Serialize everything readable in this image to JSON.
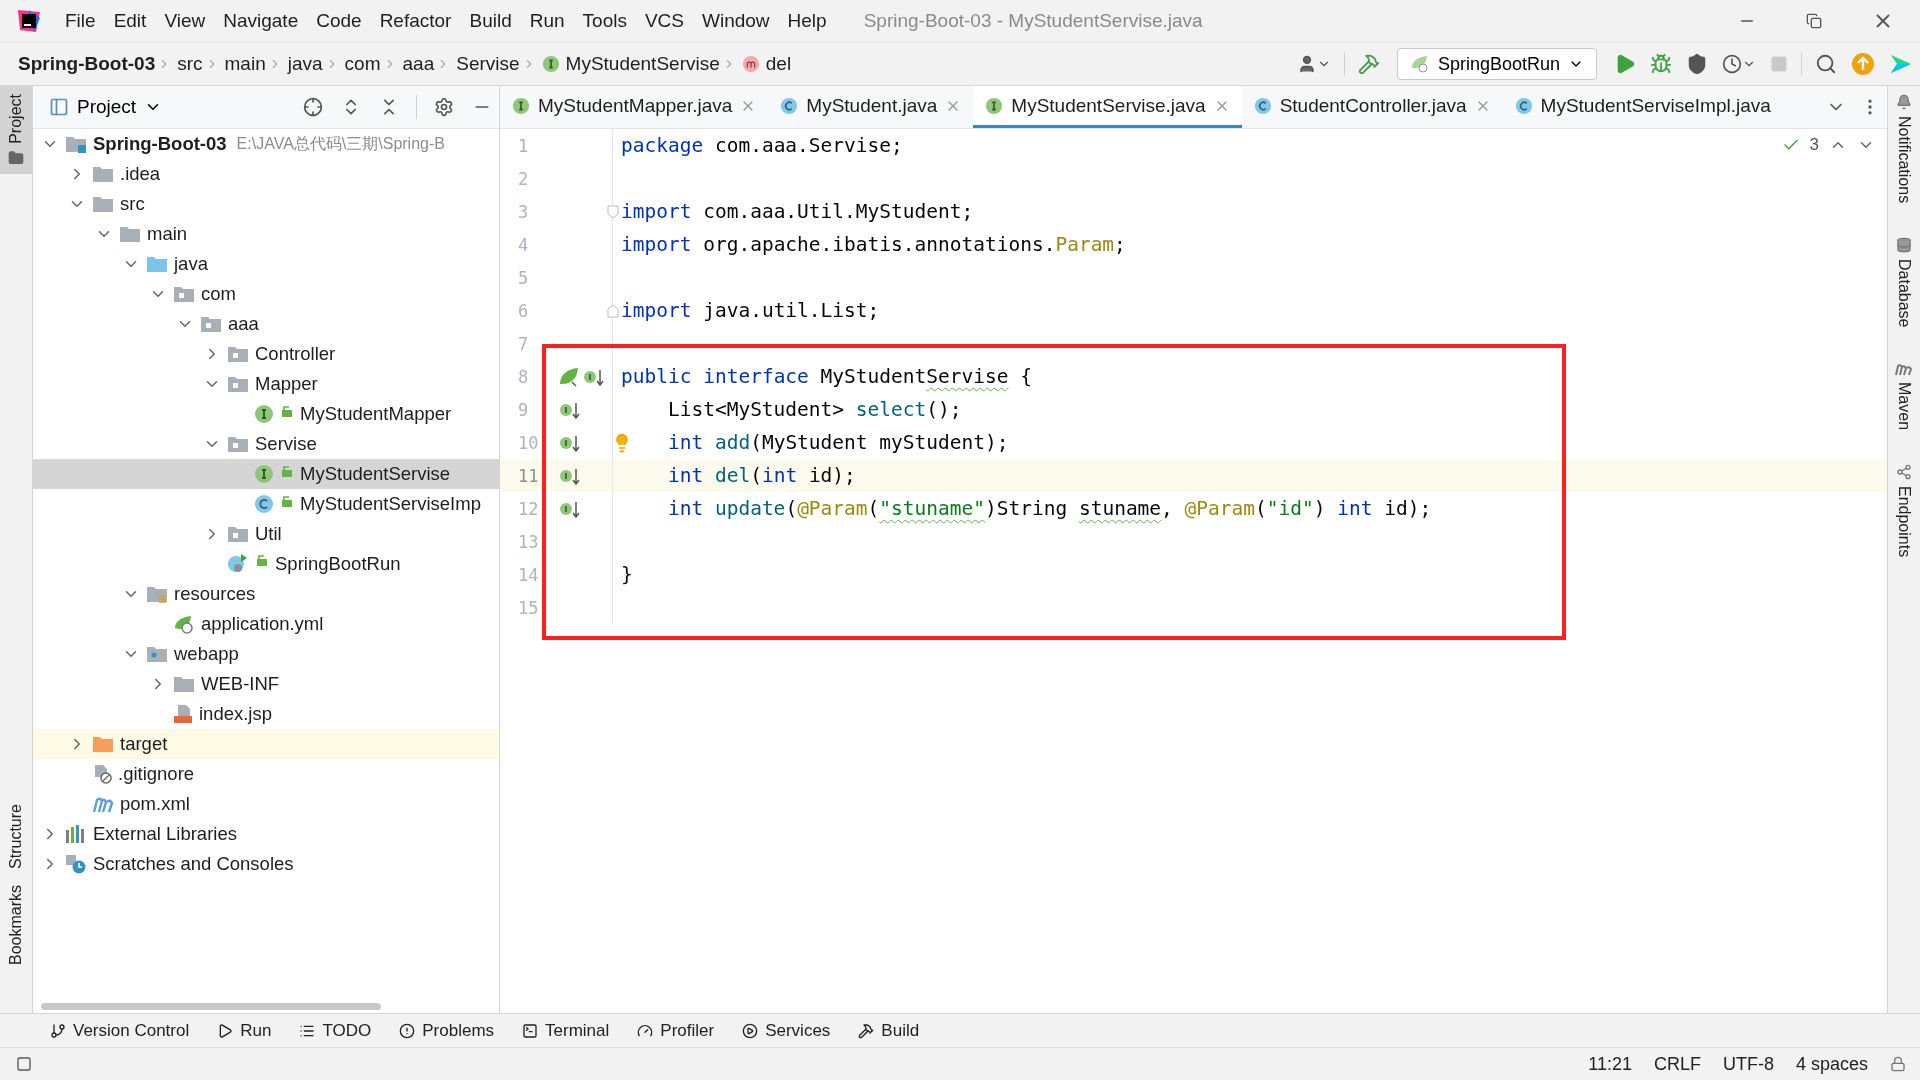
{
  "window": {
    "title": "Spring-Boot-03 - MyStudentServise.java"
  },
  "menu": [
    "File",
    "Edit",
    "View",
    "Navigate",
    "Code",
    "Refactor",
    "Build",
    "Run",
    "Tools",
    "VCS",
    "Window",
    "Help"
  ],
  "breadcrumbs": [
    {
      "label": "Spring-Boot-03",
      "kind": "module"
    },
    {
      "label": "src",
      "kind": "folder"
    },
    {
      "label": "main",
      "kind": "folder"
    },
    {
      "label": "java",
      "kind": "folder"
    },
    {
      "label": "com",
      "kind": "folder"
    },
    {
      "label": "aaa",
      "kind": "folder"
    },
    {
      "label": "Servise",
      "kind": "folder"
    },
    {
      "label": "MyStudentServise",
      "kind": "interface"
    },
    {
      "label": "del",
      "kind": "method"
    }
  ],
  "run_config": "SpringBootRun",
  "left_strip_top": [
    {
      "label": "Project",
      "selected": true
    }
  ],
  "left_strip_bottom": [
    {
      "label": "Structure",
      "selected": false
    },
    {
      "label": "Bookmarks",
      "selected": false
    }
  ],
  "right_strip": [
    {
      "label": "Notifications",
      "kind": "bell"
    },
    {
      "label": "Database",
      "kind": "database"
    },
    {
      "label": "Maven",
      "kind": "maven"
    },
    {
      "label": "Endpoints",
      "kind": "endpoints"
    }
  ],
  "project": {
    "title": "Project",
    "tree": [
      {
        "label": "Spring-Boot-03",
        "hint": "E:\\JAVA总代码\\三期\\Spring-B",
        "kind": "module",
        "expanded": true,
        "selected": false,
        "children": [
          {
            "label": ".idea",
            "kind": "folder",
            "expanded": false,
            "selected": false
          },
          {
            "label": "src",
            "kind": "folder",
            "expanded": true,
            "selected": false,
            "children": [
              {
                "label": "main",
                "kind": "folder",
                "expanded": true,
                "selected": false,
                "children": [
                  {
                    "label": "java",
                    "kind": "source-folder",
                    "expanded": true,
                    "selected": false,
                    "children": [
                      {
                        "label": "com",
                        "kind": "package",
                        "expanded": true,
                        "selected": false,
                        "children": [
                          {
                            "label": "aaa",
                            "kind": "package",
                            "expanded": true,
                            "selected": false,
                            "children": [
                              {
                                "label": "Controller",
                                "kind": "package",
                                "expanded": false,
                                "selected": false
                              },
                              {
                                "label": "Mapper",
                                "kind": "package",
                                "expanded": true,
                                "selected": false,
                                "children": [
                                  {
                                    "label": "MyStudentMapper",
                                    "kind": "interface",
                                    "selected": false
                                  }
                                ]
                              },
                              {
                                "label": "Servise",
                                "kind": "package",
                                "expanded": true,
                                "selected": false,
                                "children": [
                                  {
                                    "label": "MyStudentServise",
                                    "kind": "interface",
                                    "selected": true
                                  },
                                  {
                                    "label": "MyStudentServiseImp",
                                    "kind": "class",
                                    "selected": false
                                  }
                                ]
                              },
                              {
                                "label": "Util",
                                "kind": "package",
                                "expanded": false,
                                "selected": false
                              },
                              {
                                "label": "SpringBootRun",
                                "kind": "spring-class",
                                "selected": false
                              }
                            ]
                          }
                        ]
                      }
                    ]
                  },
                  {
                    "label": "resources",
                    "kind": "resources",
                    "expanded": true,
                    "selected": false,
                    "children": [
                      {
                        "label": "application.yml",
                        "kind": "yml",
                        "selected": false
                      }
                    ]
                  },
                  {
                    "label": "webapp",
                    "kind": "web-folder",
                    "expanded": true,
                    "selected": false,
                    "children": [
                      {
                        "label": "WEB-INF",
                        "kind": "folder",
                        "expanded": false,
                        "selected": false
                      },
                      {
                        "label": "index.jsp",
                        "kind": "jsp",
                        "selected": false
                      }
                    ]
                  }
                ]
              }
            ]
          },
          {
            "label": "target",
            "kind": "excluded-folder",
            "expanded": false,
            "selected": false
          },
          {
            "label": ".gitignore",
            "kind": "gitignore",
            "selected": false
          },
          {
            "label": "pom.xml",
            "kind": "maven",
            "selected": false
          }
        ]
      },
      {
        "label": "External Libraries",
        "kind": "libraries",
        "expanded": false,
        "selected": false
      },
      {
        "label": "Scratches and Consoles",
        "kind": "scratches",
        "expanded": false,
        "selected": false
      }
    ]
  },
  "tabs": [
    {
      "label": "MyStudentMapper.java",
      "kind": "interface",
      "selected": false,
      "closable": true
    },
    {
      "label": "MyStudent.java",
      "kind": "class",
      "selected": false,
      "closable": true
    },
    {
      "label": "MyStudentServise.java",
      "kind": "interface",
      "selected": true,
      "closable": true
    },
    {
      "label": "StudentController.java",
      "kind": "class",
      "selected": false,
      "closable": true
    },
    {
      "label": "MyStudentServiseImpl.java",
      "kind": "class",
      "selected": false,
      "closable": false
    }
  ],
  "editor": {
    "problems": "3",
    "lines": [
      {
        "number": "1",
        "current": false,
        "tokens": [
          {
            "kind": "kw",
            "text": "package"
          },
          {
            "kind": "plain",
            "text": " com.aaa.Servise;"
          }
        ]
      },
      {
        "number": "2",
        "current": false
      },
      {
        "number": "3",
        "current": false,
        "markers": [
          {
            "kind": "fold-start"
          }
        ],
        "tokens": [
          {
            "kind": "kw",
            "text": "import"
          },
          {
            "kind": "plain",
            "text": " com.aaa.Util.MyStudent;"
          }
        ]
      },
      {
        "number": "4",
        "current": false,
        "tokens": [
          {
            "kind": "kw",
            "text": "import"
          },
          {
            "kind": "plain",
            "text": " org.apache.ibatis.annotations."
          },
          {
            "kind": "annot",
            "text": "Param"
          },
          {
            "kind": "plain",
            "text": ";"
          }
        ]
      },
      {
        "number": "5",
        "current": false
      },
      {
        "number": "6",
        "current": false,
        "markers": [
          {
            "kind": "fold-end"
          }
        ],
        "tokens": [
          {
            "kind": "kw",
            "text": "import"
          },
          {
            "kind": "plain",
            "text": " java.util.List;"
          }
        ]
      },
      {
        "number": "7",
        "current": false
      },
      {
        "number": "8",
        "current": false,
        "markers": [
          {
            "kind": "bean"
          },
          {
            "kind": "implemented"
          }
        ],
        "tokens": [
          {
            "kind": "kw",
            "text": "public "
          },
          {
            "kind": "kw",
            "text": "interface"
          },
          {
            "kind": "plain",
            "text": " MyStudent"
          },
          {
            "kind": "typo",
            "text": "Servise"
          },
          {
            "kind": "plain",
            "text": " {"
          }
        ]
      },
      {
        "number": "9",
        "current": false,
        "markers": [
          {
            "kind": "implemented"
          }
        ],
        "tokens": [
          {
            "kind": "plain",
            "text": "    List<MyStudent> "
          },
          {
            "kind": "method",
            "text": "select"
          },
          {
            "kind": "plain",
            "text": "();"
          }
        ]
      },
      {
        "number": "10",
        "current": false,
        "markers": [
          {
            "kind": "implemented"
          },
          {
            "kind": "bulb"
          }
        ],
        "tokens": [
          {
            "kind": "kw",
            "text": "    int "
          },
          {
            "kind": "method",
            "text": "add"
          },
          {
            "kind": "plain",
            "text": "(MyStudent myStudent);"
          }
        ]
      },
      {
        "number": "11",
        "current": true,
        "markers": [
          {
            "kind": "implemented"
          }
        ],
        "tokens": [
          {
            "kind": "kw",
            "text": "    int "
          },
          {
            "kind": "method",
            "text": "del"
          },
          {
            "kind": "plain",
            "text": "("
          },
          {
            "kind": "kw",
            "text": "int"
          },
          {
            "kind": "plain",
            "text": " id);"
          }
        ]
      },
      {
        "number": "12",
        "current": false,
        "markers": [
          {
            "kind": "implemented"
          }
        ],
        "tokens": [
          {
            "kind": "kw",
            "text": "    int "
          },
          {
            "kind": "method",
            "text": "update"
          },
          {
            "kind": "plain",
            "text": "("
          },
          {
            "kind": "annot",
            "text": "@Param"
          },
          {
            "kind": "plain",
            "text": "("
          },
          {
            "kind": "string-typo",
            "text": "\"stuname\""
          },
          {
            "kind": "plain",
            "text": ")String "
          },
          {
            "kind": "typo",
            "text": "stuname"
          },
          {
            "kind": "plain",
            "text": ", "
          },
          {
            "kind": "annot",
            "text": "@Param"
          },
          {
            "kind": "plain",
            "text": "("
          },
          {
            "kind": "string",
            "text": "\"id\""
          },
          {
            "kind": "plain",
            "text": ") "
          },
          {
            "kind": "kw",
            "text": "int"
          },
          {
            "kind": "plain",
            "text": " id);"
          }
        ]
      },
      {
        "number": "13",
        "current": false
      },
      {
        "number": "14",
        "current": false,
        "tokens": [
          {
            "kind": "plain",
            "text": "}"
          }
        ]
      },
      {
        "number": "15",
        "current": false
      }
    ]
  },
  "tool_bar": [
    {
      "label": "Version Control",
      "kind": "vcs"
    },
    {
      "label": "Run",
      "kind": "run"
    },
    {
      "label": "TODO",
      "kind": "todo"
    },
    {
      "label": "Problems",
      "kind": "problems"
    },
    {
      "label": "Terminal",
      "kind": "terminal"
    },
    {
      "label": "Profiler",
      "kind": "profiler"
    },
    {
      "label": "Services",
      "kind": "services"
    },
    {
      "label": "Build",
      "kind": "build"
    }
  ],
  "status_bar": [
    "11:21",
    "CRLF",
    "UTF-8",
    "4 spaces"
  ]
}
